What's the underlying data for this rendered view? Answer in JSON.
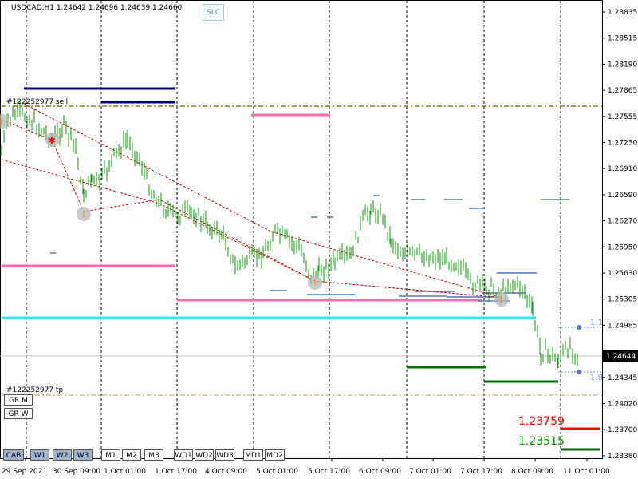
{
  "header": {
    "symbol_info": "USDCAD,H1  1.24642 1.24696 1.24639 1.24660",
    "slc_label": "SLC"
  },
  "price_axis": {
    "labels": [
      "1.28835",
      "1.28515",
      "1.28190",
      "1.27865",
      "1.27555",
      "1.27230",
      "1.26910",
      "1.26590",
      "1.26270",
      "1.25950",
      "1.25630",
      "1.25305",
      "1.24985",
      "1.24644",
      "1.24345",
      "1.24020",
      "1.23700",
      "1.23380"
    ],
    "current_price": "1.24644"
  },
  "time_axis": {
    "labels": [
      "29 Sep 2021",
      "30 Sep 09:00",
      "1 Oct 01:00",
      "1 Oct 17:00",
      "4 Oct 09:00",
      "5 Oct 01:00",
      "5 Oct 17:00",
      "6 Oct 09:00",
      "7 Oct 01:00",
      "7 Oct 17:00",
      "8 Oct 09:00",
      "11 Oct 01:00"
    ]
  },
  "orders": {
    "sell_label": "#122252977 sell",
    "tp_label": "#122252977 tp"
  },
  "side_levels": {
    "level_a": "1.1",
    "level_b": "1.8"
  },
  "big_prices": {
    "red": "1.23759",
    "green": "1.23515"
  },
  "buttons": {
    "gr_m": "GR M",
    "gr_w": "GR W",
    "bottom": [
      "CAB",
      "W1",
      "W2",
      "W3",
      "M1",
      "M2",
      "M3",
      "WD1",
      "WD2",
      "WD3",
      "MD1",
      "MD2"
    ]
  },
  "colors": {
    "navy": "#00007f",
    "pink": "#ff69b4",
    "cyan": "#33e6f0",
    "green_line": "#007000",
    "red": "#ff0000",
    "green_text": "#009000",
    "candle": "#00a000",
    "olive": "#808000",
    "orange": "#c8963c",
    "steel": "#5577bb"
  }
}
